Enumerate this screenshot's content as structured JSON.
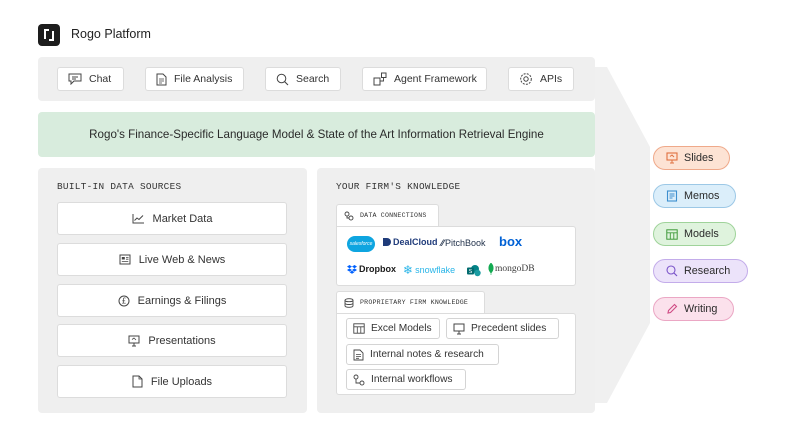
{
  "header": {
    "brand": "Rogo Platform"
  },
  "tools": [
    {
      "label": "Chat",
      "icon": "chat-icon"
    },
    {
      "label": "File Analysis",
      "icon": "file-icon"
    },
    {
      "label": "Search",
      "icon": "search-icon"
    },
    {
      "label": "Agent Framework",
      "icon": "agent-framework-icon"
    },
    {
      "label": "APIs",
      "icon": "api-gear-icon"
    }
  ],
  "banner": {
    "text": "Rogo's Finance-Specific Language Model & State of the Art Information Retrieval Engine",
    "color": "#d8ecdd"
  },
  "builtin": {
    "title": "BUILT-IN DATA SOURCES",
    "items": [
      {
        "label": "Market Data",
        "icon": "line-chart-icon"
      },
      {
        "label": "Live Web & News",
        "icon": "newspaper-icon"
      },
      {
        "label": "Earnings & Filings",
        "icon": "currency-icon"
      },
      {
        "label": "Presentations",
        "icon": "presentation-icon"
      },
      {
        "label": "File Uploads",
        "icon": "file-icon"
      }
    ]
  },
  "firm": {
    "title": "YOUR FIRM'S KNOWLEDGE",
    "connections": {
      "tab": "DATA CONNECTIONS",
      "logos": [
        "salesforce",
        "DealCloud",
        "PitchBook",
        "box",
        "Dropbox",
        "snowflake",
        "mongoDB"
      ]
    },
    "proprietary": {
      "tab": "PROPRIETARY FIRM KNOWLEDGE",
      "items": [
        {
          "label": "Excel Models",
          "icon": "table-icon"
        },
        {
          "label": "Precedent slides",
          "icon": "presentation-icon"
        },
        {
          "label": "Internal notes & research",
          "icon": "document-icon"
        },
        {
          "label": "Internal workflows",
          "icon": "workflow-icon"
        }
      ]
    }
  },
  "outputs": [
    {
      "label": "Slides",
      "icon": "presentation-icon",
      "bg": "#fde3d4",
      "border": "#efa98a",
      "iconColor": "#e0703f"
    },
    {
      "label": "Memos",
      "icon": "memo-icon",
      "bg": "#dbeefa",
      "border": "#9cc8e6",
      "iconColor": "#3d8fcf"
    },
    {
      "label": "Models",
      "icon": "table-icon",
      "bg": "#dff3dd",
      "border": "#9fd39a",
      "iconColor": "#3f9a3a"
    },
    {
      "label": "Research",
      "icon": "search-icon",
      "bg": "#ece3fa",
      "border": "#c3acea",
      "iconColor": "#7b54c9"
    },
    {
      "label": "Writing",
      "icon": "pen-icon",
      "bg": "#fbe1ec",
      "border": "#eba7c4",
      "iconColor": "#cf4a84"
    }
  ]
}
